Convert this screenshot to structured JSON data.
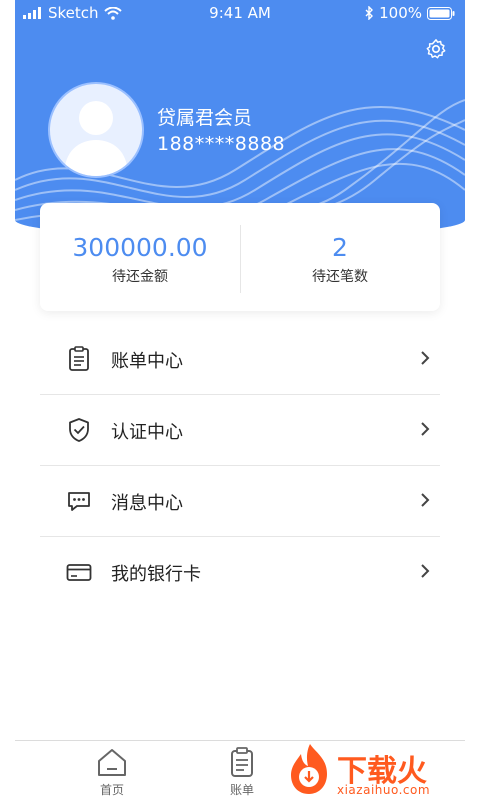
{
  "status_bar": {
    "carrier": "Sketch",
    "time": "9:41 AM",
    "battery": "100%"
  },
  "profile": {
    "member_title": "贷属君会员",
    "phone": "188****8888"
  },
  "summary": {
    "amount_value": "300000.00",
    "amount_label": "待还金额",
    "count_value": "2",
    "count_label": "待还笔数"
  },
  "menu": {
    "items": [
      {
        "label": "账单中心",
        "icon": "clipboard-icon"
      },
      {
        "label": "认证中心",
        "icon": "shield-check-icon"
      },
      {
        "label": "消息中心",
        "icon": "chat-bubble-icon"
      },
      {
        "label": "我的银行卡",
        "icon": "bank-card-icon"
      }
    ]
  },
  "tabbar": {
    "tabs": [
      {
        "label": "首页",
        "icon": "home-icon"
      },
      {
        "label": "账单",
        "icon": "bill-icon"
      }
    ]
  },
  "watermark": {
    "brand": "下载火",
    "url": "xiazaihuo.com"
  },
  "colors": {
    "accent": "#4d8cf0",
    "watermark": "#ff5a1f"
  }
}
